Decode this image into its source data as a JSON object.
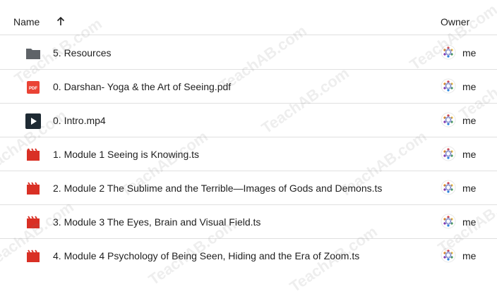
{
  "header": {
    "name_label": "Name",
    "owner_label": "Owner"
  },
  "rows": [
    {
      "name": "5. Resources",
      "owner": "me",
      "icon": "folder-icon"
    },
    {
      "name": "0. Darshan- Yoga & the Art of Seeing.pdf",
      "owner": "me",
      "icon": "pdf-icon"
    },
    {
      "name": "0. Intro.mp4",
      "owner": "me",
      "icon": "video-icon"
    },
    {
      "name": "1. Module 1 Seeing is Knowing.ts",
      "owner": "me",
      "icon": "movie-icon"
    },
    {
      "name": "2. Module 2 The Sublime and the Terrible—Images of Gods and Demons.ts",
      "owner": "me",
      "icon": "movie-icon"
    },
    {
      "name": "3. Module 3 The Eyes, Brain and Visual Field.ts",
      "owner": "me",
      "icon": "movie-icon"
    },
    {
      "name": "4. Module 4 Psychology of Being Seen, Hiding and the Era of Zoom.ts",
      "owner": "me",
      "icon": "movie-icon"
    }
  ],
  "watermark": "TeachAB.com",
  "colors": {
    "folder": "#5f6368",
    "pdf": "#ea4335",
    "movie": "#d93025",
    "video_bg": "#1e2a33",
    "divider": "#e0e0e0"
  }
}
